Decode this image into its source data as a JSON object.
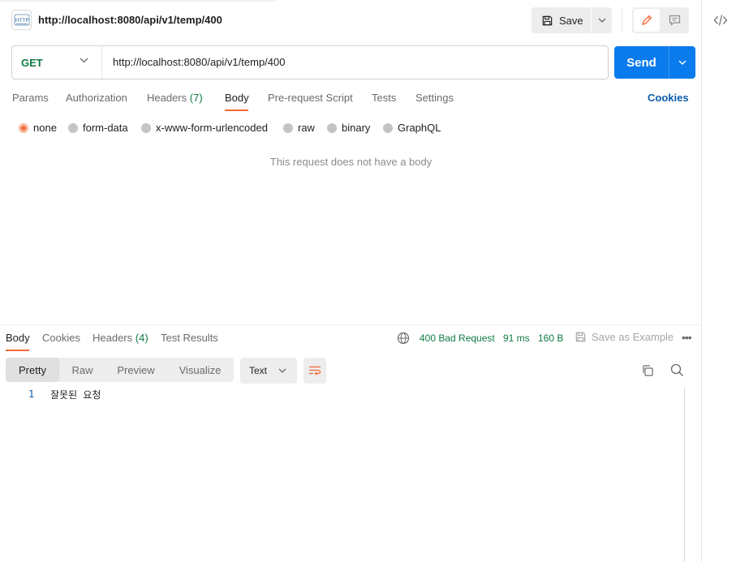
{
  "request": {
    "title": "http://localhost:8080/api/v1/temp/400",
    "method": "GET",
    "url": "http://localhost:8080/api/v1/temp/400",
    "save_label": "Save",
    "send_label": "Send"
  },
  "request_tabs": [
    {
      "label": "Params"
    },
    {
      "label": "Authorization"
    },
    {
      "label": "Headers",
      "count": "(7)"
    },
    {
      "label": "Body"
    },
    {
      "label": "Pre-request Script"
    },
    {
      "label": "Tests"
    },
    {
      "label": "Settings"
    }
  ],
  "active_request_tab": "Body",
  "cookies_label": "Cookies",
  "body_types": [
    "none",
    "form-data",
    "x-www-form-urlencoded",
    "raw",
    "binary",
    "GraphQL"
  ],
  "selected_body_type": "none",
  "no_body_message": "This request does not have a body",
  "response": {
    "tabs": [
      {
        "label": "Body"
      },
      {
        "label": "Cookies"
      },
      {
        "label": "Headers",
        "count": "(4)"
      },
      {
        "label": "Test Results"
      }
    ],
    "status": "400 Bad Request",
    "time": "91 ms",
    "size": "160 B",
    "save_example_label": "Save as Example",
    "more_label": "•••",
    "view_tabs": [
      "Pretty",
      "Raw",
      "Preview",
      "Visualize"
    ],
    "active_view": "Pretty",
    "format": "Text",
    "lines": [
      {
        "number": "1",
        "text": "잘못된 요청"
      }
    ]
  },
  "colors": {
    "accent": "#f26b3a",
    "send": "#097bed",
    "success_text": "#0f7a43",
    "link": "#0b5cad"
  },
  "icons": [
    "http-icon",
    "save-icon",
    "chevron-down-icon",
    "pencil-icon",
    "comment-icon",
    "code-icon",
    "globe-icon",
    "save-example-icon",
    "wrap-lines-icon",
    "copy-icon",
    "search-icon"
  ]
}
